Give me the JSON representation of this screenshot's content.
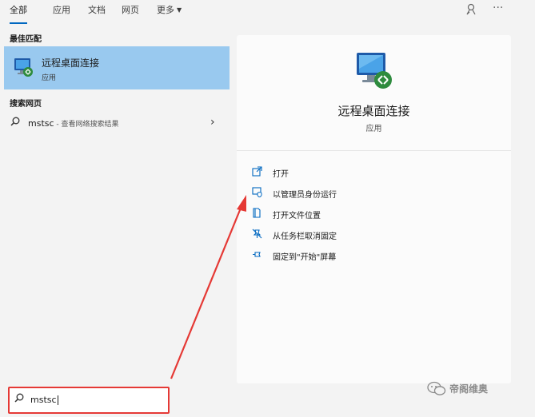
{
  "tabs": [
    {
      "label": "全部",
      "active": true
    },
    {
      "label": "应用"
    },
    {
      "label": "文档"
    },
    {
      "label": "网页"
    },
    {
      "label": "更多"
    }
  ],
  "left": {
    "best_match_header": "最佳匹配",
    "best_match": {
      "title": "远程桌面连接",
      "subtitle": "应用"
    },
    "web_header": "搜索网页",
    "web_result": {
      "query": "mstsc",
      "hint": " - 查看网络搜索结果"
    }
  },
  "right": {
    "app_title": "远程桌面连接",
    "app_type": "应用",
    "actions": [
      {
        "label": "打开",
        "icon": "open-icon"
      },
      {
        "label": "以管理员身份运行",
        "icon": "shield-run-icon"
      },
      {
        "label": "打开文件位置",
        "icon": "folder-icon"
      },
      {
        "label": "从任务栏取消固定",
        "icon": "unpin-icon"
      },
      {
        "label": "固定到\"开始\"屏幕",
        "icon": "pin-icon"
      }
    ]
  },
  "search": {
    "value": "mstsc"
  },
  "watermark": {
    "text": "帝阁维奥"
  },
  "colors": {
    "accent": "#0067c0",
    "highlight": "#99c9ef",
    "annotation": "#e53935"
  }
}
